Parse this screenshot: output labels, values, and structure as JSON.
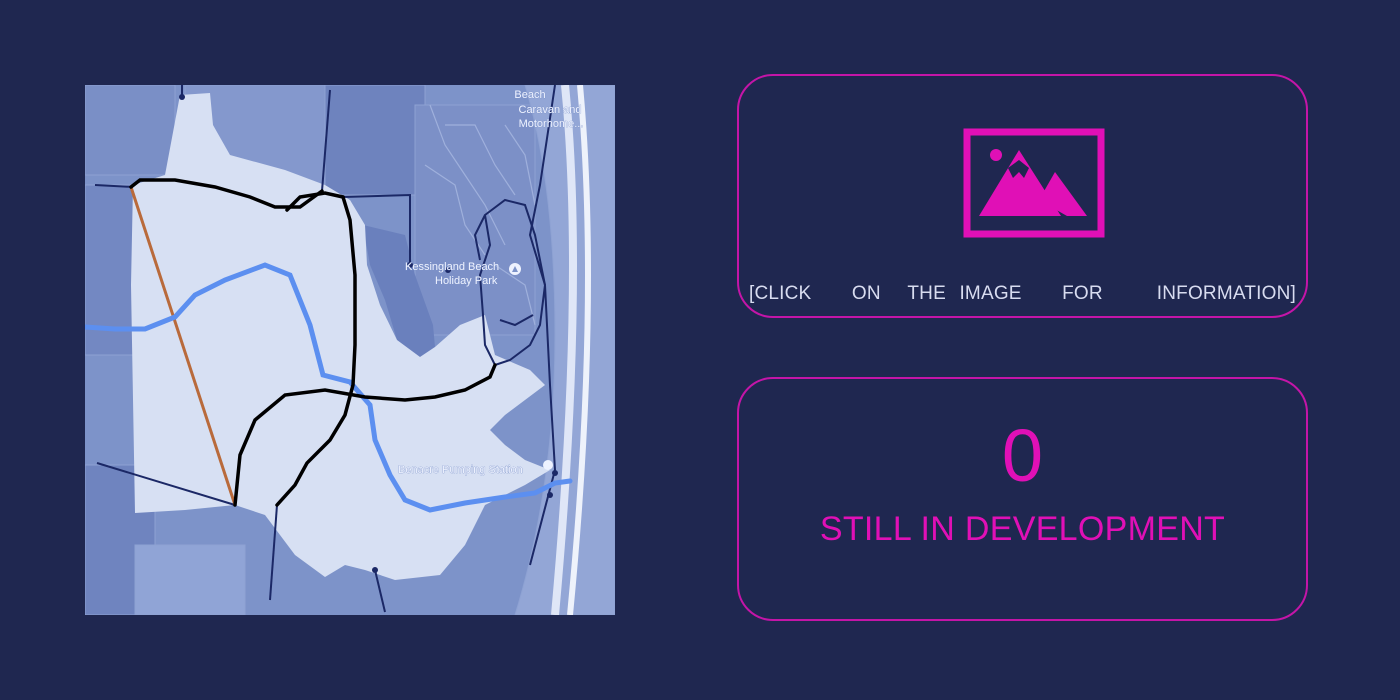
{
  "map": {
    "labels": [
      {
        "text": "Beach"
      },
      {
        "text": "Caravan and"
      },
      {
        "text": "Motorhome..."
      },
      {
        "text": "Kessingland Beach"
      },
      {
        "text": "Holiday Park"
      },
      {
        "text": "Benacre Pumping Station"
      }
    ]
  },
  "info_card": {
    "icon": "image-icon",
    "hint": "[CLICK   ON  THE IMAGE   FOR    INFORMATION]"
  },
  "status_card": {
    "count": "0",
    "status": "STILL IN DEVELOPMENT"
  },
  "colors": {
    "background": "#1f2750",
    "accent": "#e010b6",
    "card_border": "#c415a8",
    "map_base": "#7d93c9",
    "map_highlight": "#d7e0f3",
    "river": "#5c8ff0",
    "path": "#000000"
  }
}
